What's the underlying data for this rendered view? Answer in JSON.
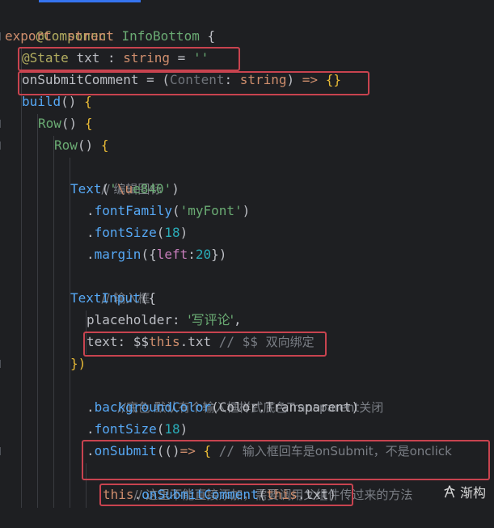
{
  "editor": {
    "lines": [
      {
        "text": "@Component"
      },
      {
        "text": "export  struct InfoBottom {"
      },
      {
        "text": "@State txt : string = ''"
      },
      {
        "text": "onSubmitComment = (Content: string) => {}"
      },
      {
        "text": "build() {"
      },
      {
        "text": "Row() {"
      },
      {
        "text": "Row() {"
      },
      {
        "text": "// 编辑图标"
      },
      {
        "text": "Text('\\ue840')"
      },
      {
        "text": ".fontFamily('myFont')"
      },
      {
        "text": ".fontSize(18)"
      },
      {
        "text": ".margin({left:20})"
      },
      {
        "text": "// 输入框"
      },
      {
        "text": "TextInput({"
      },
      {
        "text": "placeholder: '写评论',"
      },
      {
        "text": "text: $$this.txt // $$ 双向绑定"
      },
      {
        "text": "})"
      },
      {
        "text": "//底色 默认有个输入框样式底色Transparent关闭"
      },
      {
        "text": ".backgroundColor(Color.Transparent)"
      },
      {
        "text": ".fontSize(18)"
      },
      {
        "text": ".onSubmit(()=> { // 输入框回车是onSubmit，不是onclick"
      },
      {
        "text": "// 这里不能直接添加，需要调用父组件传过来的方法"
      },
      {
        "text": "this.onSubmitComment(this.txt)"
      }
    ]
  },
  "watermark": {
    "text": "渐构",
    "icon": "logo-icon"
  },
  "colors": {
    "background": "#1e1f22",
    "highlight_box": "#c8434f",
    "keyword": "#cf8e6d",
    "function": "#56a8f5",
    "string": "#6aab73"
  }
}
